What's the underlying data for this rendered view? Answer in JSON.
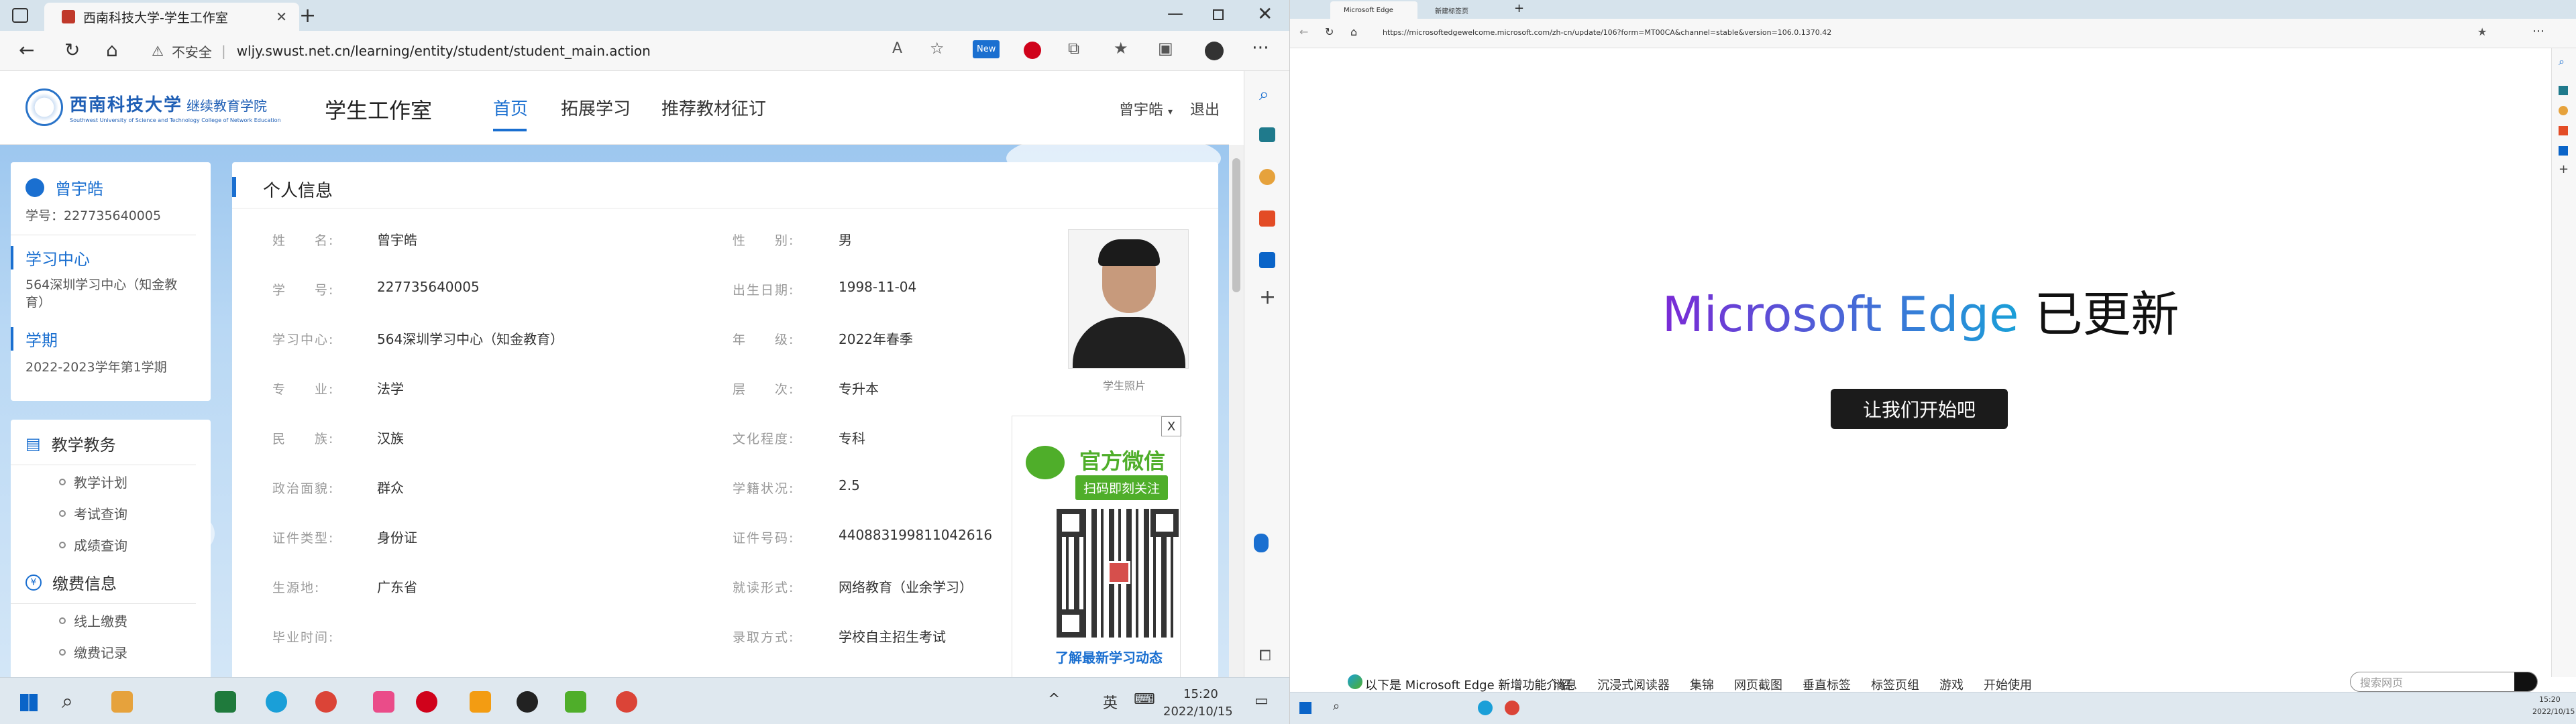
{
  "left_browser": {
    "tab_title": "西南科技大学-学生工作室",
    "security_label": "不安全",
    "url": "wljy.swust.net.cn/learning/entity/student/student_main.action",
    "new_badge": "New"
  },
  "site": {
    "logo_cn": "西南科技大学",
    "logo_sub_cn": "继续教育学院",
    "logo_en": "Southwest University of Science and Technology College of Network Education",
    "section_title": "学生工作室",
    "nav": [
      "首页",
      "拓展学习",
      "推荐教材征订"
    ],
    "user_menu": "曾宇皓",
    "logout": "退出"
  },
  "sidebar": {
    "student_name": "曾宇皓",
    "student_id": "学号：227735640005",
    "center_title": "学习中心",
    "center_value": "564深圳学习中心（知金教育）",
    "term_title": "学期",
    "term_value": "2022-2023学年第1学期",
    "teaching_title": "教学教务",
    "teaching_items": [
      "教学计划",
      "考试查询",
      "成绩查询"
    ],
    "payment_title": "缴费信息",
    "payment_items": [
      "线上缴费",
      "缴费记录"
    ]
  },
  "profile": {
    "title": "个人信息",
    "photo_caption": "学生照片",
    "left_fields": [
      {
        "label": "姓　　名:",
        "value": "曾宇皓"
      },
      {
        "label": "学　　号:",
        "value": "227735640005"
      },
      {
        "label": "学习中心:",
        "value": "564深圳学习中心（知金教育）"
      },
      {
        "label": "专　　业:",
        "value": "法学"
      },
      {
        "label": "民　　族:",
        "value": "汉族"
      },
      {
        "label": "政治面貌:",
        "value": "群众"
      },
      {
        "label": "证件类型:",
        "value": "身份证"
      },
      {
        "label": "生源地:",
        "value": "广东省"
      },
      {
        "label": "毕业时间:",
        "value": ""
      }
    ],
    "right_fields": [
      {
        "label": "性　　别:",
        "value": "男"
      },
      {
        "label": "出生日期:",
        "value": "1998-11-04"
      },
      {
        "label": "年　　级:",
        "value": "2022年春季"
      },
      {
        "label": "层　　次:",
        "value": "专升本"
      },
      {
        "label": "文化程度:",
        "value": "专科"
      },
      {
        "label": "学籍状况:",
        "value": "2.5"
      },
      {
        "label": "证件号码:",
        "value": "440883199811042616"
      },
      {
        "label": "就读形式:",
        "value": "网络教育（业余学习）"
      },
      {
        "label": "录取方式:",
        "value": "学校自主招生考试"
      }
    ]
  },
  "wechat_popup": {
    "close": "X",
    "title": "官方微信",
    "subtitle": "扫码即刻关注",
    "footer": "了解最新学习动态"
  },
  "left_taskbar": {
    "ime": "英",
    "time": "15:20",
    "date": "2022/10/15"
  },
  "right_browser": {
    "tab1": "Microsoft Edge",
    "tab2": "新建标签页",
    "url": "https://microsoftedgewelcome.microsoft.com/zh-cn/update/106?form=MT00CA&channel=stable&version=106.0.1370.42",
    "headline_brand": "Microsoft Edge",
    "headline_suffix": "已更新",
    "cta": "让我们开始吧",
    "footer_intro": "以下是 Microsoft Edge 新增功能介绍",
    "footer_links": [
      "消息",
      "沉浸式阅读器",
      "集锦",
      "网页截图",
      "垂直标签",
      "标签页组",
      "游戏",
      "开始使用"
    ],
    "search_placeholder": "搜索网页",
    "time": "15:20",
    "date": "2022/10/15"
  },
  "colors": {
    "accent_blue": "#1a6fd0",
    "wechat_green": "#4fae2a",
    "edge_gradient_start": "#7a2ad6",
    "edge_gradient_end": "#1aa0d8"
  }
}
